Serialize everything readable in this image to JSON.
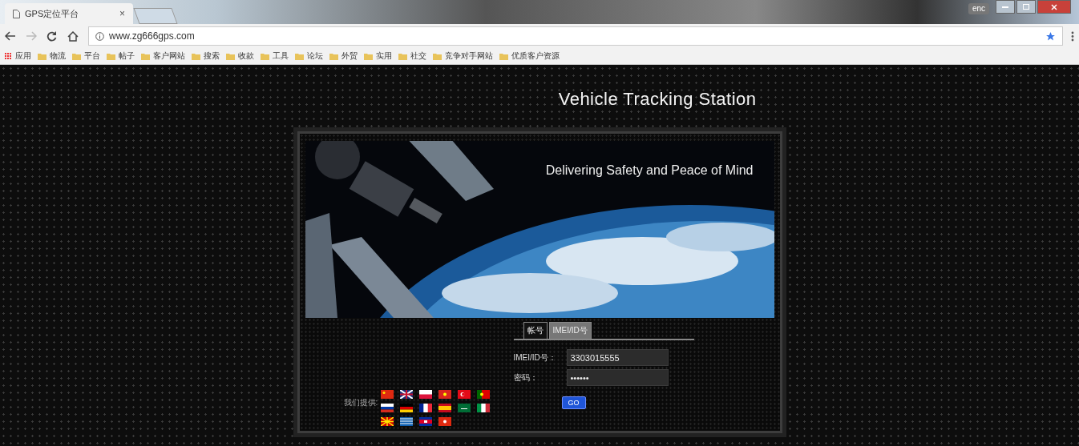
{
  "browser": {
    "tab_title": "GPS定位平台",
    "tab_close": "×",
    "ime": "enc",
    "url": "www.zg666gps.com",
    "bookmarks": [
      "应用",
      "物流",
      "平台",
      "帖子",
      "客户网站",
      "搜索",
      "收款",
      "工具",
      "论坛",
      "外贸",
      "实用",
      "社交",
      "竞争对手网站",
      "优质客户资源"
    ]
  },
  "page": {
    "title": "Vehicle Tracking Station",
    "subtitle": "Delivering Safety and Peace of Mind",
    "tabs": [
      {
        "label": "帐号",
        "selected": false
      },
      {
        "label": "IMEI/ID号",
        "selected": true
      }
    ],
    "fields": [
      {
        "label": "IMEI/ID号：",
        "value": "3303015555",
        "kind": "text"
      },
      {
        "label": "密码：",
        "value": "••••••",
        "kind": "password"
      }
    ],
    "submit": "GO",
    "languages_label": "我们提供:"
  }
}
